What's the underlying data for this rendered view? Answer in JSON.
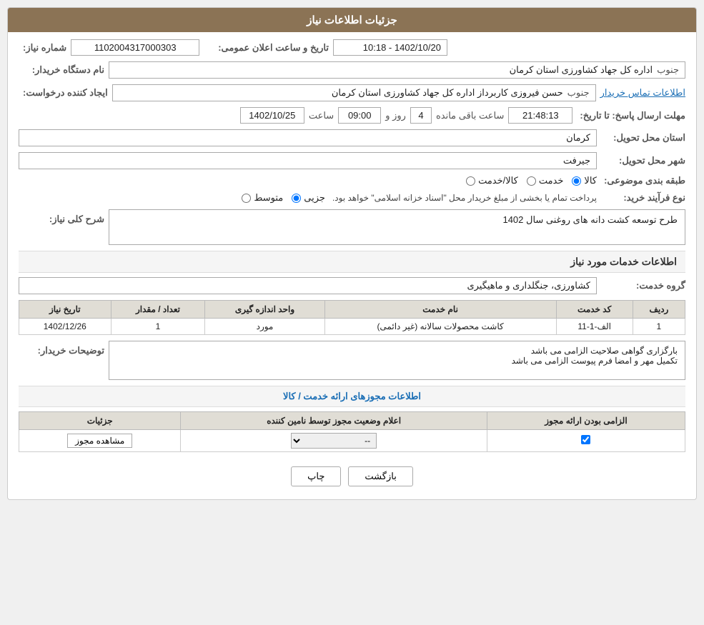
{
  "header": {
    "title": "جزئیات اطلاعات نیاز"
  },
  "fields": {
    "need_number_label": "شماره نیاز:",
    "need_number_value": "1102004317000303",
    "date_label": "تاریخ و ساعت اعلان عمومی:",
    "date_value": "1402/10/20 - 10:18",
    "buyer_org_label": "نام دستگاه خریدار:",
    "buyer_org_value": "اداره کل جهاد کشاورزی استان کرمان",
    "buyer_org_region": "جنوب",
    "creator_label": "ایجاد کننده درخواست:",
    "creator_value": "حسن فیروزی کاربرداز اداره کل جهاد کشاورزی استان کرمان",
    "creator_region": "جنوب",
    "contact_link": "اطلاعات تماس خریدار",
    "deadline_label": "مهلت ارسال پاسخ: تا تاریخ:",
    "deadline_date": "1402/10/25",
    "deadline_time_label": "ساعت",
    "deadline_time": "09:00",
    "remaining_days_label": "روز و",
    "remaining_days": "4",
    "remaining_time_label": "ساعت باقی مانده",
    "remaining_time": "21:48:13",
    "province_label": "استان محل تحویل:",
    "province_value": "کرمان",
    "city_label": "شهر محل تحویل:",
    "city_value": "جیرفت",
    "category_label": "طبقه بندی موضوعی:",
    "category_options": [
      "کالا",
      "خدمت",
      "کالا/خدمت"
    ],
    "category_selected": "کالا",
    "purchase_type_label": "نوع فرآیند خرید:",
    "purchase_options": [
      "جزیی",
      "متوسط"
    ],
    "purchase_note": "پرداخت تمام یا بخشی از مبلغ خریدار محل \"اسناد خزانه اسلامی\" خواهد بود.",
    "description_label": "شرح کلی نیاز:",
    "description_value": "طرح توسعه کشت دانه های روغنی سال 1402"
  },
  "service_section": {
    "title": "اطلاعات خدمات مورد نیاز",
    "service_group_label": "گروه خدمت:",
    "service_group_value": "کشاورزی، جنگلداری و ماهیگیری",
    "table": {
      "headers": [
        "ردیف",
        "کد خدمت",
        "نام خدمت",
        "واحد اندازه گیری",
        "تعداد / مقدار",
        "تاریخ نیاز"
      ],
      "rows": [
        {
          "row": "1",
          "code": "الف-1-11",
          "name": "کاشت محصولات سالانه (غیر دائمی)",
          "unit": "مورد",
          "qty": "1",
          "date": "1402/12/26"
        }
      ]
    },
    "buyer_desc_label": "توضیحات خریدار:",
    "buyer_desc_line1": "بارگزاری گواهی صلاحیت الزامی می باشد",
    "buyer_desc_line2": "تکمیل مهر و امضا فرم پیوست الزامی می باشد"
  },
  "license_section": {
    "title": "اطلاعات مجوزهای ارائه خدمت / کالا",
    "table": {
      "headers": [
        "الزامی بودن ارائه مجوز",
        "اعلام وضعیت مجوز توسط نامین کننده",
        "جزئیات"
      ],
      "rows": [
        {
          "required": true,
          "status": "--",
          "details_btn": "مشاهده مجوز"
        }
      ]
    }
  },
  "buttons": {
    "print": "چاپ",
    "back": "بازگشت"
  }
}
